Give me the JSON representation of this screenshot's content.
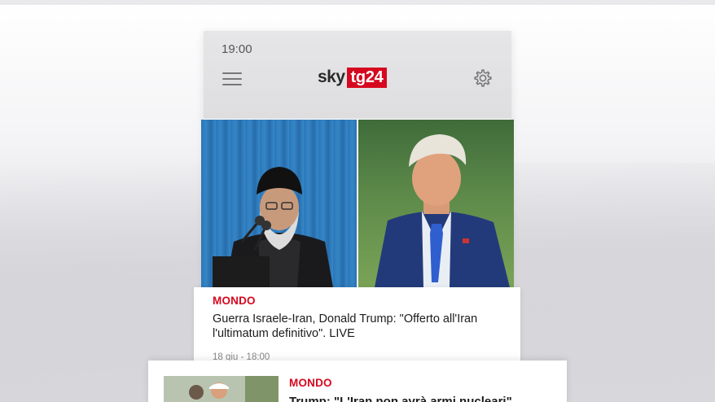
{
  "status_bar": {
    "time": "19:00"
  },
  "header": {
    "logo_sky": "sky",
    "logo_tg": "tg24",
    "menu_icon": "hamburger-menu-icon",
    "settings_icon": "gear-icon"
  },
  "hero": {
    "left_image": "photo of speaker at microphones before blue curtain",
    "right_image": "photo of man in navy suit and blue tie outdoors"
  },
  "articles": [
    {
      "category": "MONDO",
      "headline": "Guerra Israele-Iran, Donald Trump: \"Offerto all'Iran l'ultimatum definitivo\". LIVE",
      "date": "18 giu - 18:00"
    },
    {
      "category": "MONDO",
      "headline": "Trump: \"L'Iran non avrà armi nucleari\""
    }
  ],
  "colors": {
    "accent_red": "#d6081f",
    "header_bg": "#e2e2e4",
    "text": "#1c1c1c"
  }
}
